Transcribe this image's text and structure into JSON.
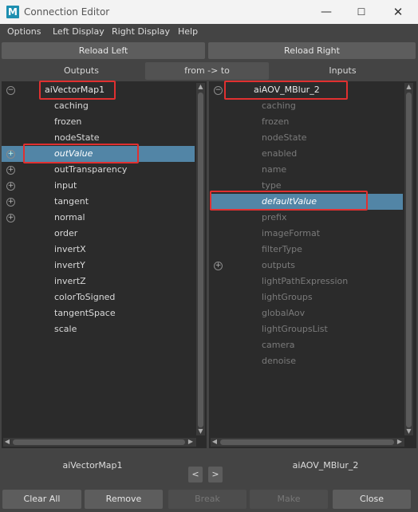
{
  "window": {
    "title": "Connection Editor",
    "app_letter": "M",
    "minimize_glyph": "—",
    "maximize_glyph": "☐",
    "close_glyph": "✕"
  },
  "menu": [
    "Options",
    "Left Display",
    "Right Display",
    "Help"
  ],
  "reload": {
    "left": "Reload Left",
    "right": "Reload Right"
  },
  "headers": {
    "outputs": "Outputs",
    "direction": "from -> to",
    "inputs": "Inputs"
  },
  "left_list": {
    "node": "aiVectorMap1",
    "items": [
      "caching",
      "frozen",
      "nodeState",
      "outValue",
      "outTransparency",
      "input",
      "tangent",
      "normal",
      "order",
      "invertX",
      "invertY",
      "invertZ",
      "colorToSigned",
      "tangentSpace",
      "scale"
    ],
    "selected": "outValue"
  },
  "right_list": {
    "node": "aiAOV_MBlur_2",
    "items": [
      "caching",
      "frozen",
      "nodeState",
      "enabled",
      "name",
      "type",
      "defaultValue",
      "prefix",
      "imageFormat",
      "filterType",
      "outputs",
      "lightPathExpression",
      "lightGroups",
      "globalAov",
      "lightGroupsList",
      "camera",
      "denoise"
    ],
    "selected": "defaultValue"
  },
  "bottom": {
    "left_node": "aiVectorMap1",
    "right_node": "aiAOV_MBlur_2",
    "prev": "<",
    "next": ">"
  },
  "buttons": {
    "clear_all": "Clear All",
    "remove": "Remove",
    "break": "Break",
    "make": "Make",
    "close": "Close"
  },
  "colors": {
    "selection": "#5285a6",
    "highlight_box": "#e03030",
    "background": "#444444",
    "list_bg": "#2b2b2b"
  }
}
